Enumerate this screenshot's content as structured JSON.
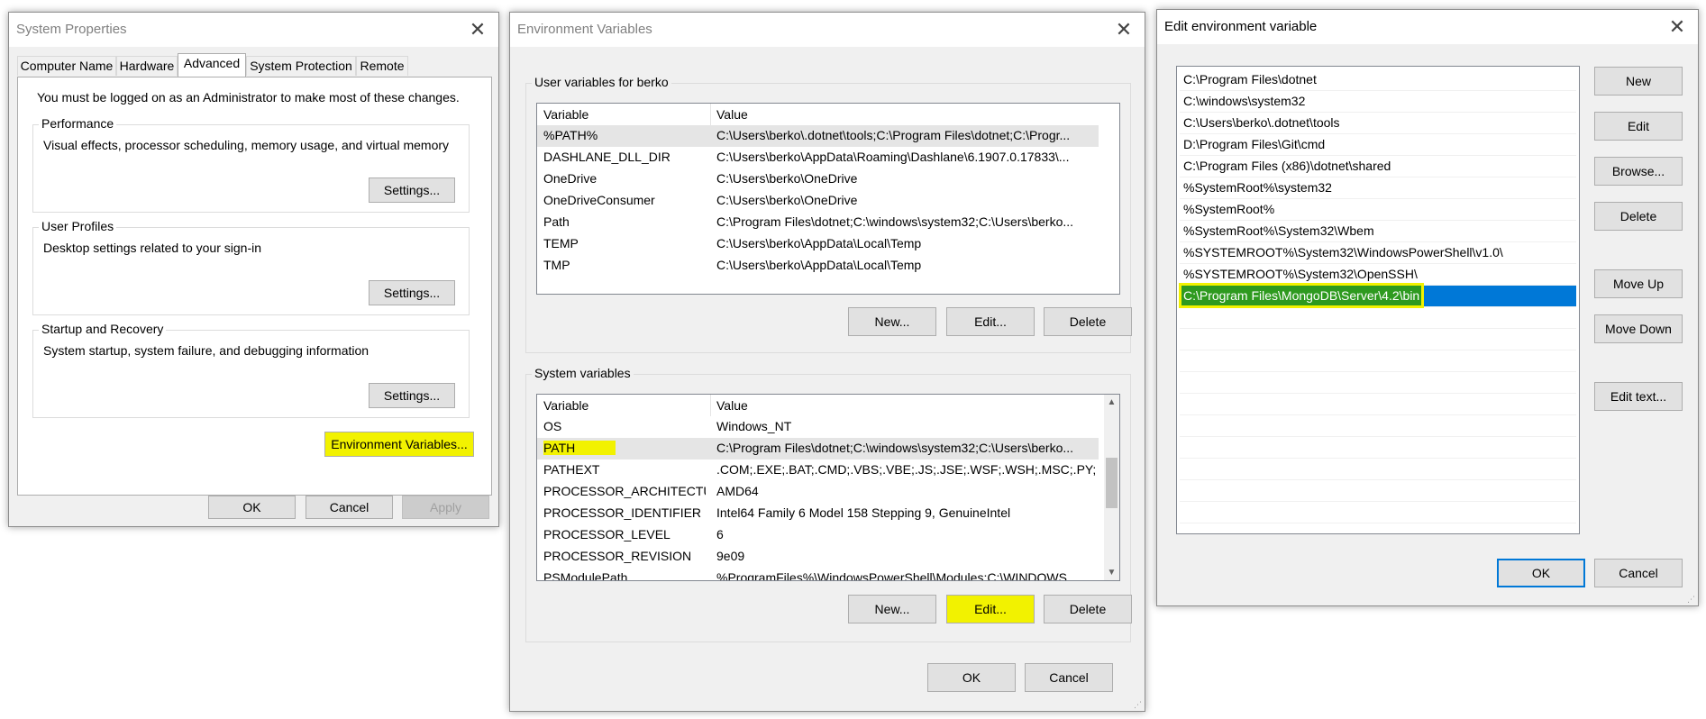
{
  "sys_props": {
    "title": "System Properties",
    "tabs": [
      "Computer Name",
      "Hardware",
      "Advanced",
      "System Protection",
      "Remote"
    ],
    "admin_note": "You must be logged on as an Administrator to make most of these changes.",
    "performance": {
      "title": "Performance",
      "desc": "Visual effects, processor scheduling, memory usage, and virtual memory",
      "button": "Settings..."
    },
    "profiles": {
      "title": "User Profiles",
      "desc": "Desktop settings related to your sign-in",
      "button": "Settings..."
    },
    "startup": {
      "title": "Startup and Recovery",
      "desc": "System startup, system failure, and debugging information",
      "button": "Settings..."
    },
    "env_button": "Environment Variables...",
    "ok": "OK",
    "cancel": "Cancel",
    "apply": "Apply"
  },
  "env_vars": {
    "title": "Environment Variables",
    "user_group": "User variables for berko",
    "col_variable": "Variable",
    "col_value": "Value",
    "user_vars": [
      {
        "name": "%PATH%",
        "value": "C:\\Users\\berko\\.dotnet\\tools;C:\\Program Files\\dotnet;C:\\Progr..."
      },
      {
        "name": "DASHLANE_DLL_DIR",
        "value": "C:\\Users\\berko\\AppData\\Roaming\\Dashlane\\6.1907.0.17833\\..."
      },
      {
        "name": "OneDrive",
        "value": "C:\\Users\\berko\\OneDrive"
      },
      {
        "name": "OneDriveConsumer",
        "value": "C:\\Users\\berko\\OneDrive"
      },
      {
        "name": "Path",
        "value": "C:\\Program Files\\dotnet;C:\\windows\\system32;C:\\Users\\berko..."
      },
      {
        "name": "TEMP",
        "value": "C:\\Users\\berko\\AppData\\Local\\Temp"
      },
      {
        "name": "TMP",
        "value": "C:\\Users\\berko\\AppData\\Local\\Temp"
      }
    ],
    "user_buttons": {
      "new": "New...",
      "edit": "Edit...",
      "delete": "Delete"
    },
    "system_group": "System variables",
    "system_vars": [
      {
        "name": "OS",
        "value": "Windows_NT"
      },
      {
        "name": "PATH",
        "value": "C:\\Program Files\\dotnet;C:\\windows\\system32;C:\\Users\\berko..."
      },
      {
        "name": "PATHEXT",
        "value": ".COM;.EXE;.BAT;.CMD;.VBS;.VBE;.JS;.JSE;.WSF;.WSH;.MSC;.PY;.PYW"
      },
      {
        "name": "PROCESSOR_ARCHITECTU...",
        "value": "AMD64"
      },
      {
        "name": "PROCESSOR_IDENTIFIER",
        "value": "Intel64 Family 6 Model 158 Stepping 9, GenuineIntel"
      },
      {
        "name": "PROCESSOR_LEVEL",
        "value": "6"
      },
      {
        "name": "PROCESSOR_REVISION",
        "value": "9e09"
      },
      {
        "name": "PSModulePath",
        "value": "%ProgramFiles%\\WindowsPowerShell\\Modules;C:\\WINDOWS..."
      }
    ],
    "system_buttons": {
      "new": "New...",
      "edit": "Edit...",
      "delete": "Delete"
    },
    "ok": "OK",
    "cancel": "Cancel"
  },
  "edit_env": {
    "title": "Edit environment variable",
    "paths": [
      "C:\\Program Files\\dotnet",
      "C:\\windows\\system32",
      "C:\\Users\\berko\\.dotnet\\tools",
      "D:\\Program Files\\Git\\cmd",
      "C:\\Program Files (x86)\\dotnet\\shared",
      "%SystemRoot%\\system32",
      "%SystemRoot%",
      "%SystemRoot%\\System32\\Wbem",
      "%SYSTEMROOT%\\System32\\WindowsPowerShell\\v1.0\\",
      "%SYSTEMROOT%\\System32\\OpenSSH\\",
      "C:\\Program Files\\MongoDB\\Server\\4.2\\bin"
    ],
    "buttons": {
      "new": "New",
      "edit": "Edit",
      "browse": "Browse...",
      "delete": "Delete",
      "move_up": "Move Up",
      "move_down": "Move Down",
      "edit_text": "Edit text..."
    },
    "ok": "OK",
    "cancel": "Cancel"
  },
  "colors": {
    "selection": "#0078d7",
    "highlight": "#f2f200",
    "window_bg": "#f0f0f0"
  }
}
